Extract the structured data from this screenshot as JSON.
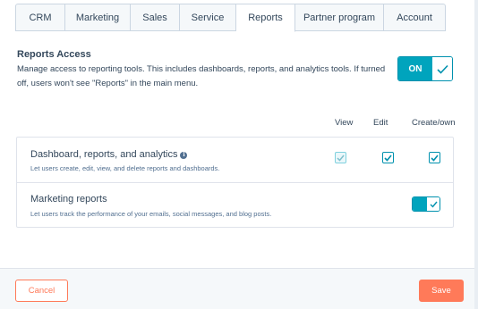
{
  "tabs": [
    {
      "label": "CRM",
      "active": false
    },
    {
      "label": "Marketing",
      "active": false
    },
    {
      "label": "Sales",
      "active": false
    },
    {
      "label": "Service",
      "active": false
    },
    {
      "label": "Reports",
      "active": true
    },
    {
      "label": "Partner program",
      "active": false
    },
    {
      "label": "Account",
      "active": false
    }
  ],
  "reports_access": {
    "title": "Reports Access",
    "description": "Manage access to reporting tools. This includes dashboards, reports, and analytics tools. If turned off, users won't see \"Reports\" in the main menu.",
    "toggle_label": "ON",
    "enabled": true
  },
  "columns": {
    "view": "View",
    "edit": "Edit",
    "create_own": "Create/own"
  },
  "permissions": [
    {
      "title": "Dashboard, reports, and analytics",
      "description": "Let users create, edit, view, and delete reports and dashboards.",
      "view": true,
      "view_disabled": true,
      "edit": true,
      "create_own": true
    },
    {
      "title": "Marketing reports",
      "description": "Let users track the performance of your emails, social messages, and blog posts.",
      "enabled": true
    }
  ],
  "footer": {
    "cancel_label": "Cancel",
    "save_label": "Save"
  },
  "colors": {
    "accent": "#00a4bd",
    "accent_border": "#0091ae",
    "primary_button": "#ff7a59",
    "text": "#33475b"
  }
}
